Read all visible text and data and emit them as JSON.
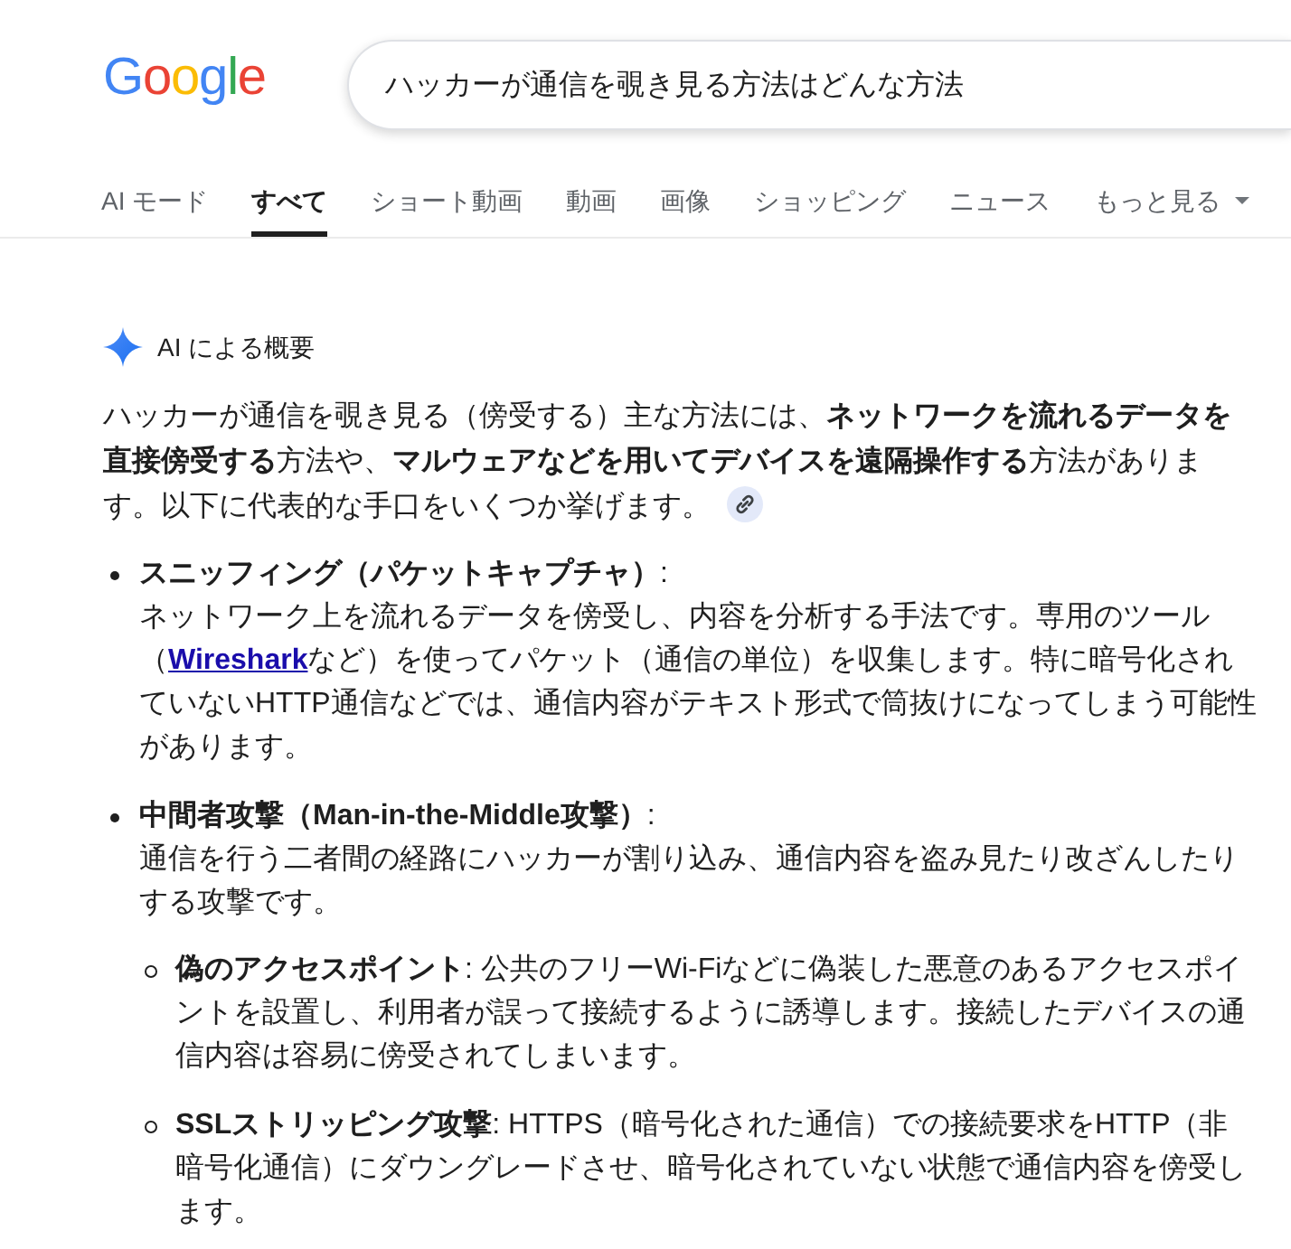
{
  "header": {
    "logo": "Google",
    "search": {
      "value": "ハッカーが通信を覗き見る方法はどんな方法"
    }
  },
  "tabs": [
    {
      "label": "AI モード",
      "kind": "tab",
      "selected": false
    },
    {
      "label": "すべて",
      "kind": "tab",
      "selected": true
    },
    {
      "label": "ショート動画",
      "kind": "tab",
      "selected": false
    },
    {
      "label": "動画",
      "kind": "tab",
      "selected": false
    },
    {
      "label": "画像",
      "kind": "tab",
      "selected": false
    },
    {
      "label": "ショッピング",
      "kind": "tab",
      "selected": false
    },
    {
      "label": "ニュース",
      "kind": "tab",
      "selected": false
    },
    {
      "label": "もっと見る",
      "kind": "menu",
      "selected": false
    }
  ],
  "ai_overview": {
    "title": "AI による概要",
    "summary": "ハッカーが通信を覗き見る（傍受する）主な方法には、**ネットワークを流れるデータを直接傍受する**方法や、**マルウェアなどを用いてデバイスを遠隔操作する**方法があります。以下に代表的な手口をいくつか挙げます。",
    "items": [
      {
        "title": "**スニッフィング（パケットキャプチャ）**:",
        "description": [
          {
            "kind": "text",
            "text": "ネットワーク上を流れるデータを傍受し、内容を分析する手法です。専用のツール（"
          },
          {
            "kind": "link",
            "text": "Wireshark"
          },
          {
            "kind": "text",
            "text": "など）を使ってパケット（通信の単位）を収集します。特に暗号化されていないHTTP通信などでは、通信内容がテキスト形式で筒抜けになってしまう可能性があります。"
          }
        ]
      },
      {
        "title": "**中間者攻撃（Man-in-the-Middle攻撃）**:",
        "description": [
          {
            "kind": "text",
            "text": "通信を行う二者間の経路にハッカーが割り込み、通信内容を盗み見たり改ざんしたりする攻撃です。"
          }
        ],
        "children": [
          {
            "text": "**偽のアクセスポイント**: 公共のフリーWi-Fiなどに偽装した悪意のあるアクセスポイントを設置し、利用者が誤って接続するように誘導します。接続したデバイスの通信内容は容易に傍受されてしまいます。"
          },
          {
            "text": "**SSLストリッピング攻撃**: HTTPS（暗号化された通信）での接続要求をHTTP（非暗号化通信）にダウングレードさせ、暗号化されていない状態で通信内容を傍受します。"
          }
        ]
      }
    ]
  }
}
